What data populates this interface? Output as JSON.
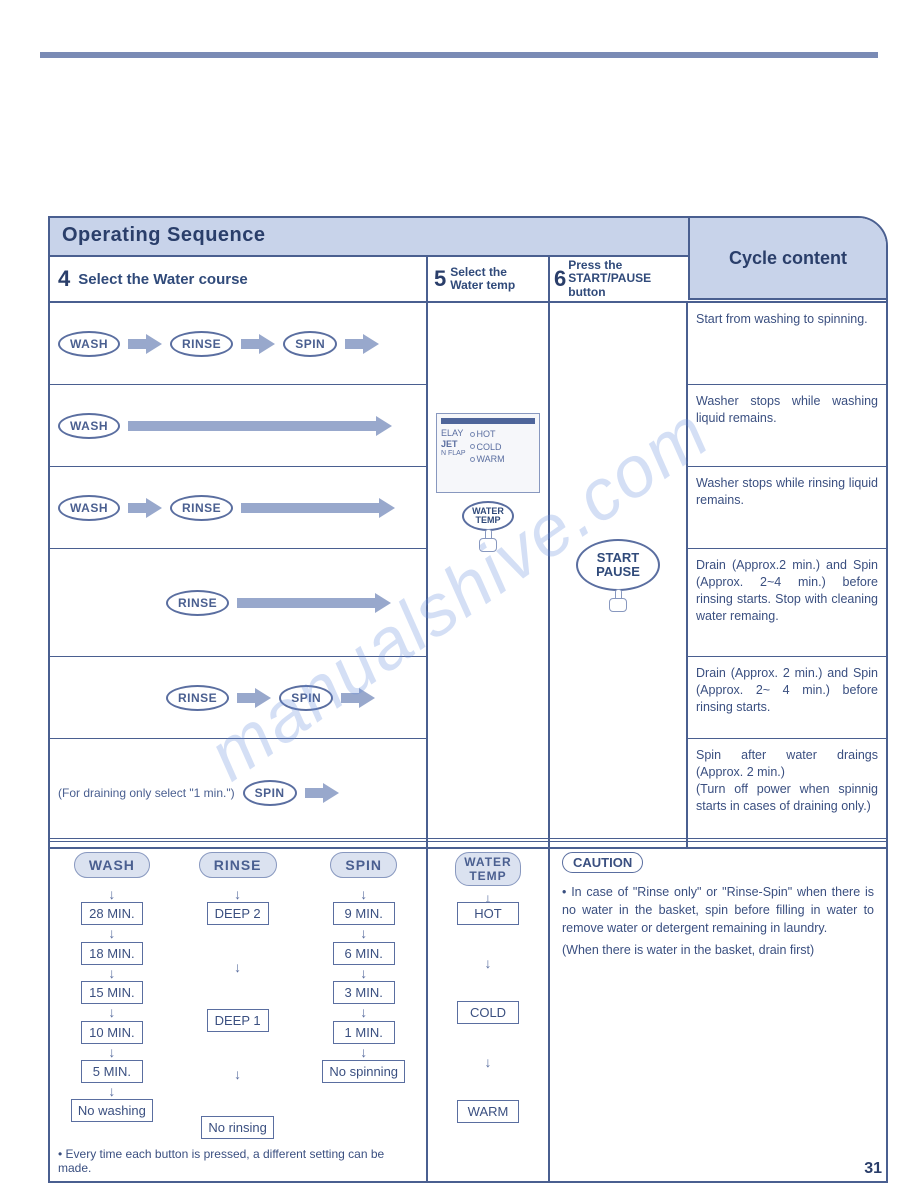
{
  "watermark": "manualshive.com",
  "page_number": "31",
  "op_seq_title": "Operating Sequence",
  "cycle_title": "Cycle content",
  "step4": {
    "num": "4",
    "label": "Select the Water course"
  },
  "step5": {
    "num": "5",
    "label": "Select the\nWater temp"
  },
  "step6": {
    "num": "6",
    "label": "Press the\nSTART/PAUSE\nbutton"
  },
  "buttons": {
    "wash": "WASH",
    "rinse": "RINSE",
    "spin": "SPIN",
    "start_pause": "START\nPAUSE",
    "water_temp": "WATER\nTEMP"
  },
  "panel": {
    "elay": "ELAY",
    "jet": "JET",
    "flap": "N FLAP",
    "hot": "HOT",
    "cold": "COLD",
    "warm": "WARM"
  },
  "drain_note": "(For draining only select \"1 min.\")",
  "cycle_rows": [
    "Start from washing to spinning.",
    "Washer stops while washing liquid remains.",
    "Washer stops while rinsing liquid remains.",
    "Drain (Approx.2 min.) and Spin (Approx. 2~4 min.) before rinsing starts. Stop with cleaning water remaing.",
    "Drain (Approx. 2 min.) and Spin (Approx. 2~ 4 min.) before rinsing starts.",
    "Spin after water draings (Approx. 2 min.)\n(Turn off power when spinnig starts in cases of draining only.)"
  ],
  "flows": {
    "wash": {
      "title": "WASH",
      "items": [
        "28 MIN.",
        "18 MIN.",
        "15 MIN.",
        "10 MIN.",
        "5 MIN.",
        "No washing"
      ]
    },
    "rinse": {
      "title": "RINSE",
      "items": [
        "DEEP 2",
        "DEEP 1",
        "No rinsing"
      ]
    },
    "spin": {
      "title": "SPIN",
      "items": [
        "9 MIN.",
        "6 MIN.",
        "3 MIN.",
        "1 MIN.",
        "No spinning"
      ]
    },
    "temp": {
      "title": "WATER\nTEMP",
      "items": [
        "HOT",
        "COLD",
        "WARM"
      ]
    }
  },
  "flow_footnote": "Every time each button is pressed, a different setting can be made.",
  "caution": {
    "label": "CAUTION",
    "text": "In case of \"Rinse only\" or \"Rinse-Spin\" when there is no water in the basket, spin before filling in water to remove water or detergent remaining in laundry.",
    "sub": "(When there is water in the basket, drain first)"
  }
}
